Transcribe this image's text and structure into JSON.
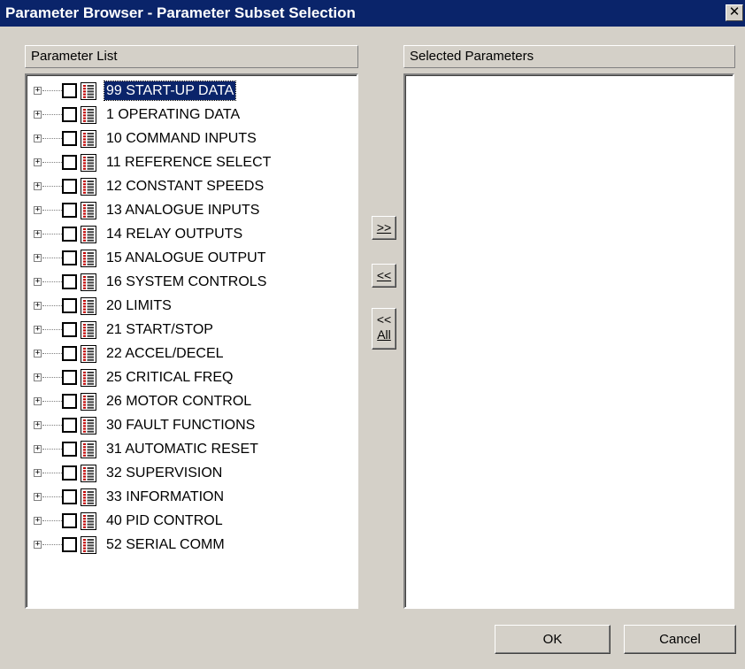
{
  "window": {
    "title": "Parameter Browser - Parameter Subset Selection",
    "close_glyph": "✕"
  },
  "left_panel": {
    "header": "Parameter List"
  },
  "right_panel": {
    "header": "Selected Parameters"
  },
  "tree": {
    "items": [
      {
        "label": "99  START-UP DATA",
        "selected": true
      },
      {
        "label": "1  OPERATING DATA"
      },
      {
        "label": "10  COMMAND INPUTS"
      },
      {
        "label": "11  REFERENCE SELECT"
      },
      {
        "label": "12  CONSTANT SPEEDS"
      },
      {
        "label": "13  ANALOGUE INPUTS"
      },
      {
        "label": "14  RELAY OUTPUTS"
      },
      {
        "label": "15  ANALOGUE OUTPUT"
      },
      {
        "label": "16  SYSTEM CONTROLS"
      },
      {
        "label": "20  LIMITS"
      },
      {
        "label": "21  START/STOP"
      },
      {
        "label": "22  ACCEL/DECEL"
      },
      {
        "label": "25  CRITICAL FREQ"
      },
      {
        "label": "26  MOTOR CONTROL"
      },
      {
        "label": "30  FAULT FUNCTIONS"
      },
      {
        "label": "31  AUTOMATIC RESET"
      },
      {
        "label": "32  SUPERVISION"
      },
      {
        "label": "33  INFORMATION"
      },
      {
        "label": "40  PID CONTROL"
      },
      {
        "label": "52  SERIAL COMM"
      }
    ],
    "expander_glyph": "+",
    "icons": {
      "checkbox": "checkbox-icon",
      "list": "parameter-group-icon"
    }
  },
  "buttons": {
    "add": ">>",
    "remove": "<<",
    "remove_all_top": "<<",
    "remove_all_bottom": "All",
    "ok": "OK",
    "cancel": "Cancel"
  },
  "colors": {
    "title_bar": "#0a246a",
    "dialog_bg": "#d4d0c8",
    "selection": "#0a246a",
    "icon_bullet": "#c00000"
  }
}
